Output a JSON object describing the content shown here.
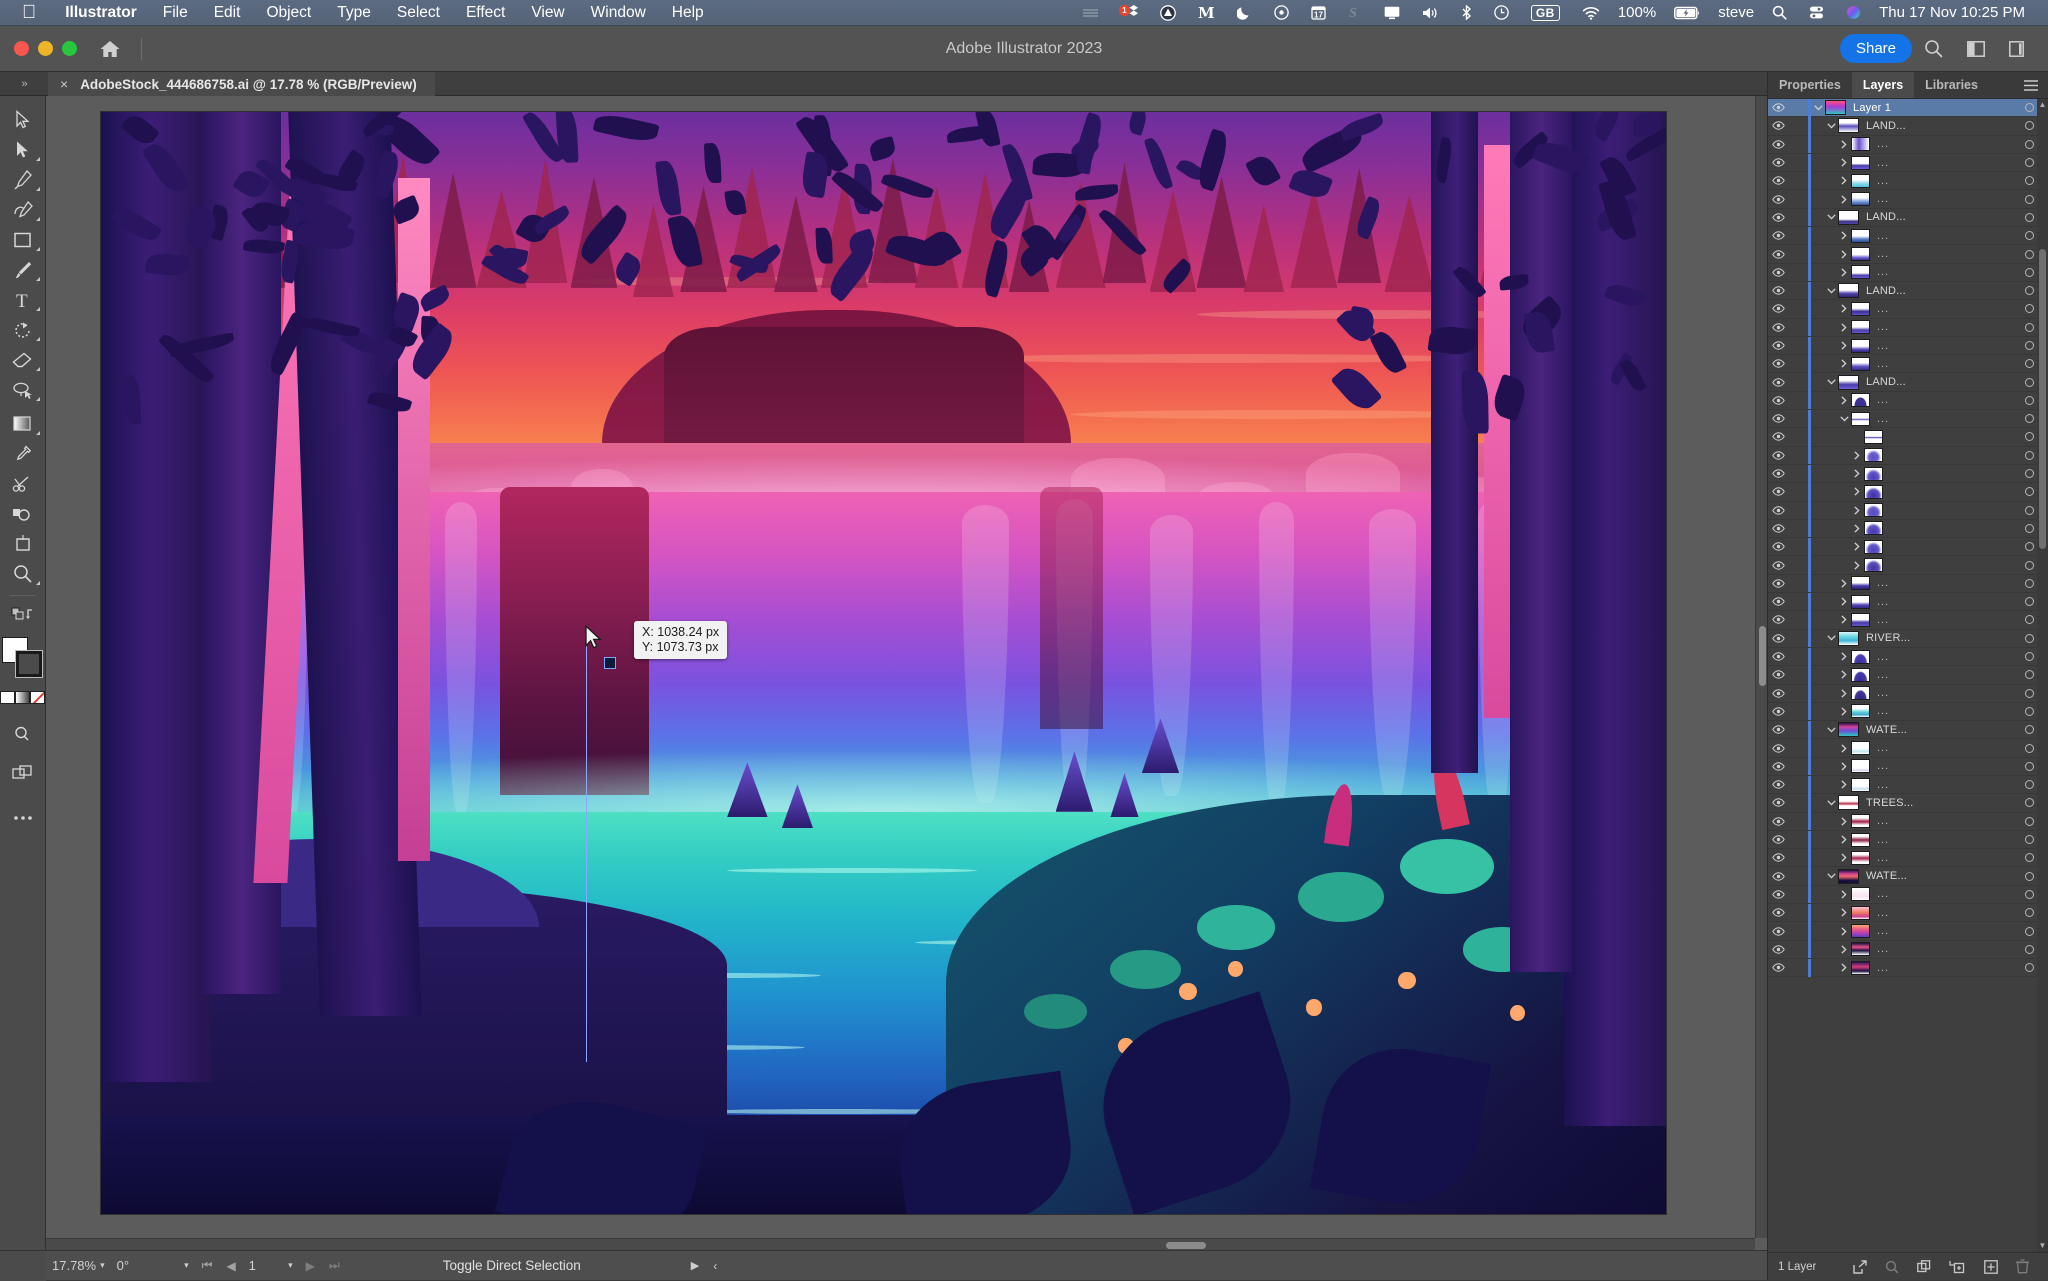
{
  "macmenu": {
    "apple_icon": "apple-icon",
    "items": [
      {
        "label": "Illustrator",
        "bold": true
      },
      {
        "label": "File",
        "bold": false
      },
      {
        "label": "Edit",
        "bold": false
      },
      {
        "label": "Object",
        "bold": false
      },
      {
        "label": "Type",
        "bold": false
      },
      {
        "label": "Select",
        "bold": false
      },
      {
        "label": "Effect",
        "bold": false
      },
      {
        "label": "View",
        "bold": false
      },
      {
        "label": "Window",
        "bold": false
      },
      {
        "label": "Help",
        "bold": false
      }
    ],
    "status_icons": [
      "screenshot-icon",
      "dropbox-icon",
      "backup-icon",
      "malwarebytes-icon",
      "do-not-disturb-moon-icon",
      "play-circle-icon",
      "calendar-17-icon",
      "sketch-s-icon",
      "display-icon",
      "volume-icon",
      "bluetooth-icon",
      "time-machine-icon"
    ],
    "keyboard_layout": "GB",
    "wifi_icon": "wifi-icon",
    "battery_percent": "100%",
    "battery_icon": "battery-charging-icon",
    "user": "steve",
    "search_icon": "spotlight-search-icon",
    "control_center_icon": "control-center-icon",
    "siri_icon": "siri-icon",
    "datetime": "Thu 17 Nov  10:25 PM"
  },
  "titlebar": {
    "home_icon": "home-icon",
    "app_title": "Adobe Illustrator 2023",
    "share_label": "Share",
    "search_icon": "search-icon",
    "arrange_icon": "arrange-documents-icon",
    "workspace_icon": "workspace-switcher-icon"
  },
  "tabbar": {
    "collapse_icon": "»",
    "document_tab": {
      "close_icon": "×",
      "title": "AdobeStock_444686758.ai @ 17.78 % (RGB/Preview)"
    }
  },
  "toolbar": {
    "tools": [
      {
        "name": "selection-tool"
      },
      {
        "name": "direct-selection-tool"
      },
      {
        "name": "pen-tool"
      },
      {
        "name": "curvature-tool"
      },
      {
        "name": "rectangle-tool"
      },
      {
        "name": "paintbrush-tool"
      },
      {
        "name": "type-tool"
      },
      {
        "name": "rotate-tool"
      },
      {
        "name": "eraser-tool"
      },
      {
        "name": "lasso-tool"
      },
      {
        "name": "gradient-tool"
      },
      {
        "name": "eyedropper-tool"
      },
      {
        "name": "scissors-tool"
      },
      {
        "name": "shape-builder-tool"
      },
      {
        "name": "artboard-tool"
      },
      {
        "name": "zoom-tool"
      }
    ],
    "fill_color": "#ffffff",
    "stroke_color": "#000000",
    "swap_icon": "swap-fill-stroke-icon",
    "default_colors_icon": "default-fill-stroke-icon",
    "color_mode_icons": [
      "color-swatch",
      "gradient-swatch",
      "none-swatch"
    ],
    "drawing_mode_icon": "draw-normal-icon",
    "screen_mode_icon": "change-screen-mode-icon",
    "more_tools_icon": "edit-toolbar-ellipsis-icon"
  },
  "canvas": {
    "cursor_icon": "direct-selection-arrow-cursor",
    "tooltip": {
      "x_label": "X: 1038.24 px",
      "y_label": "Y: 1073.73 px"
    },
    "anchor_point_icon": "anchor-point-marker"
  },
  "statusbar": {
    "zoom_level": "17.78%",
    "rotation": "0°",
    "artboard_number": "1",
    "first_icon": "first-artboard-icon",
    "prev_icon": "previous-artboard-icon",
    "next_icon": "next-artboard-icon",
    "last_icon": "last-artboard-icon",
    "status_text": "Toggle Direct Selection",
    "menu_arrow": "▶",
    "resize_arrow": "‹"
  },
  "panel": {
    "tabs": [
      {
        "label": "Properties",
        "active": false
      },
      {
        "label": "Layers",
        "active": true
      },
      {
        "label": "Libraries",
        "active": false
      }
    ],
    "menu_icon": "panel-menu-hamburger-icon",
    "footer": {
      "count_label": "1 Layer",
      "icons": [
        "locate-object-icon",
        "search-layers-icon",
        "make-clipping-mask-icon",
        "create-new-sublayer-icon",
        "create-new-layer-icon",
        "delete-selection-icon"
      ]
    },
    "layers": [
      {
        "name": "Layer 1",
        "indent": 0,
        "twisty": "down",
        "selected": true,
        "thumb": "thumb-layer1"
      },
      {
        "name": "LAND...",
        "indent": 1,
        "twisty": "down",
        "selected": false,
        "thumb": "thumb-land1"
      },
      {
        "name": "...",
        "indent": 2,
        "twisty": "right",
        "selected": false,
        "thumb": "thumb-trunk"
      },
      {
        "name": "...",
        "indent": 2,
        "twisty": "right",
        "selected": false,
        "thumb": "thumb-ridge"
      },
      {
        "name": "...",
        "indent": 2,
        "twisty": "right",
        "selected": false,
        "thumb": "thumb-dome"
      },
      {
        "name": "...",
        "indent": 2,
        "twisty": "right",
        "selected": false,
        "thumb": "thumb-shore"
      },
      {
        "name": "LAND...",
        "indent": 1,
        "twisty": "down",
        "selected": false,
        "thumb": "thumb-land2"
      },
      {
        "name": "...",
        "indent": 2,
        "twisty": "right",
        "selected": false,
        "thumb": "thumb-ridge2"
      },
      {
        "name": "...",
        "indent": 2,
        "twisty": "right",
        "selected": false,
        "thumb": "thumb-ridge3"
      },
      {
        "name": "...",
        "indent": 2,
        "twisty": "right",
        "selected": false,
        "thumb": "thumb-ridge4"
      },
      {
        "name": "LAND...",
        "indent": 1,
        "twisty": "down",
        "selected": false,
        "thumb": "thumb-land3"
      },
      {
        "name": "...",
        "indent": 2,
        "twisty": "right",
        "selected": false,
        "thumb": "thumb-hill"
      },
      {
        "name": "...",
        "indent": 2,
        "twisty": "right",
        "selected": false,
        "thumb": "thumb-hill2"
      },
      {
        "name": "...",
        "indent": 2,
        "twisty": "right",
        "selected": false,
        "thumb": "thumb-hill3"
      },
      {
        "name": "...",
        "indent": 2,
        "twisty": "right",
        "selected": false,
        "thumb": "thumb-hill4"
      },
      {
        "name": "LAND...",
        "indent": 1,
        "twisty": "down",
        "selected": false,
        "thumb": "thumb-land4"
      },
      {
        "name": "...",
        "indent": 2,
        "twisty": "right",
        "selected": false,
        "thumb": "thumb-dome2"
      },
      {
        "name": "...",
        "indent": 2,
        "twisty": "down",
        "selected": false,
        "thumb": "thumb-water"
      },
      {
        "name": "",
        "indent": 3,
        "twisty": "none",
        "selected": false,
        "thumb": "thumb-band"
      },
      {
        "name": "",
        "indent": 3,
        "twisty": "right",
        "selected": false,
        "thumb": "thumb-bush1"
      },
      {
        "name": "",
        "indent": 3,
        "twisty": "right",
        "selected": false,
        "thumb": "thumb-bush2"
      },
      {
        "name": "",
        "indent": 3,
        "twisty": "right",
        "selected": false,
        "thumb": "thumb-bush3"
      },
      {
        "name": "",
        "indent": 3,
        "twisty": "right",
        "selected": false,
        "thumb": "thumb-bush4"
      },
      {
        "name": "",
        "indent": 3,
        "twisty": "right",
        "selected": false,
        "thumb": "thumb-bush5"
      },
      {
        "name": "",
        "indent": 3,
        "twisty": "right",
        "selected": false,
        "thumb": "thumb-bush6"
      },
      {
        "name": "",
        "indent": 3,
        "twisty": "right",
        "selected": false,
        "thumb": "thumb-bush7"
      },
      {
        "name": "...",
        "indent": 2,
        "twisty": "right",
        "selected": false,
        "thumb": "thumb-misc1"
      },
      {
        "name": "...",
        "indent": 2,
        "twisty": "right",
        "selected": false,
        "thumb": "thumb-misc2"
      },
      {
        "name": "...",
        "indent": 2,
        "twisty": "right",
        "selected": false,
        "thumb": "thumb-misc3"
      },
      {
        "name": "RIVER...",
        "indent": 1,
        "twisty": "down",
        "selected": false,
        "thumb": "thumb-river"
      },
      {
        "name": "...",
        "indent": 2,
        "twisty": "right",
        "selected": false,
        "thumb": "thumb-peak1"
      },
      {
        "name": "...",
        "indent": 2,
        "twisty": "right",
        "selected": false,
        "thumb": "thumb-peak2"
      },
      {
        "name": "...",
        "indent": 2,
        "twisty": "right",
        "selected": false,
        "thumb": "thumb-peak3"
      },
      {
        "name": "...",
        "indent": 2,
        "twisty": "right",
        "selected": false,
        "thumb": "thumb-riverband"
      },
      {
        "name": "WATE...",
        "indent": 1,
        "twisty": "down",
        "selected": false,
        "thumb": "thumb-wate1"
      },
      {
        "name": "...",
        "indent": 2,
        "twisty": "right",
        "selected": false,
        "thumb": "thumb-pale1"
      },
      {
        "name": "...",
        "indent": 2,
        "twisty": "right",
        "selected": false,
        "thumb": "thumb-pale2"
      },
      {
        "name": "...",
        "indent": 2,
        "twisty": "right",
        "selected": false,
        "thumb": "thumb-pale3"
      },
      {
        "name": "TREES...",
        "indent": 1,
        "twisty": "down",
        "selected": false,
        "thumb": "thumb-trees"
      },
      {
        "name": "...",
        "indent": 2,
        "twisty": "right",
        "selected": false,
        "thumb": "thumb-tree1"
      },
      {
        "name": "...",
        "indent": 2,
        "twisty": "right",
        "selected": false,
        "thumb": "thumb-tree2"
      },
      {
        "name": "...",
        "indent": 2,
        "twisty": "right",
        "selected": false,
        "thumb": "thumb-tree3"
      },
      {
        "name": "WATE...",
        "indent": 1,
        "twisty": "down",
        "selected": false,
        "thumb": "thumb-wate2"
      },
      {
        "name": "...",
        "indent": 2,
        "twisty": "right",
        "selected": false,
        "thumb": "thumb-sky1"
      },
      {
        "name": "...",
        "indent": 2,
        "twisty": "right",
        "selected": false,
        "thumb": "thumb-sky2"
      },
      {
        "name": "...",
        "indent": 2,
        "twisty": "right",
        "selected": false,
        "thumb": "thumb-sky3"
      },
      {
        "name": "...",
        "indent": 2,
        "twisty": "right",
        "selected": false,
        "thumb": "thumb-sky4"
      },
      {
        "name": "...",
        "indent": 2,
        "twisty": "right",
        "selected": false,
        "thumb": "thumb-sky5"
      }
    ]
  },
  "colors": {
    "accent_blue": "#1473e6",
    "panel_bg": "#3f3f3f",
    "toolbar_bg": "#4b4b4b",
    "canvas_bg": "#5c5c5c",
    "selection_blue": "#5a7ba8",
    "layer_color_bar": "#4a7fd4",
    "menubar_bg": "#566377"
  }
}
